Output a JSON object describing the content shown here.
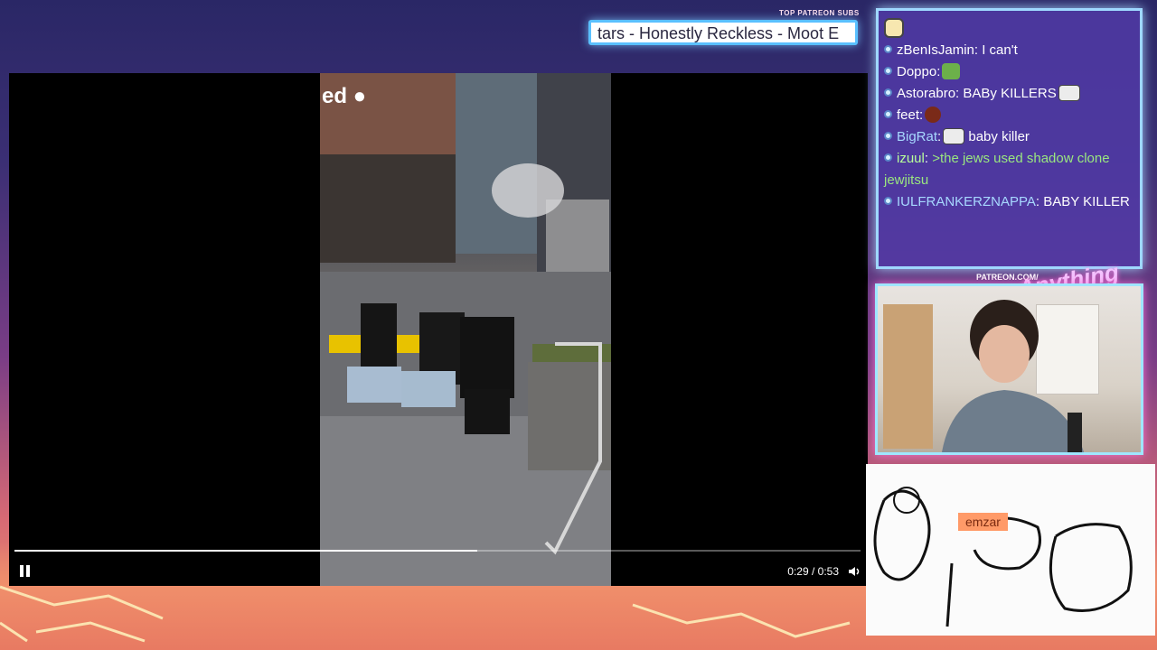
{
  "overlay": {
    "patreon_label": "TOP PATREON SUBS",
    "ticker_text": "tars - Honestly Reckless - Moot E",
    "patreon_mini": "PATREON.COM/",
    "cam_title": "Anything Else?"
  },
  "video": {
    "overlay_text": "ed ●",
    "time": "0:29 / 0:53",
    "progress": 0.547
  },
  "chat": {
    "messages": [
      {
        "user": "zBenIsJamin",
        "text": " I can't"
      },
      {
        "user": "Doppo",
        "text": ""
      },
      {
        "user": "Astorabro",
        "text": " BABy KILLERS"
      },
      {
        "user": "feet",
        "text": ""
      },
      {
        "user": "BigRat",
        "text": " baby killer"
      },
      {
        "user": "izuul",
        "text": " >the jews used shadow clone jewjitsu"
      },
      {
        "user": "IULFRANKERZNAPPA",
        "text": " BABY KILLER"
      }
    ]
  },
  "drawing": {
    "tag": "emzar"
  }
}
